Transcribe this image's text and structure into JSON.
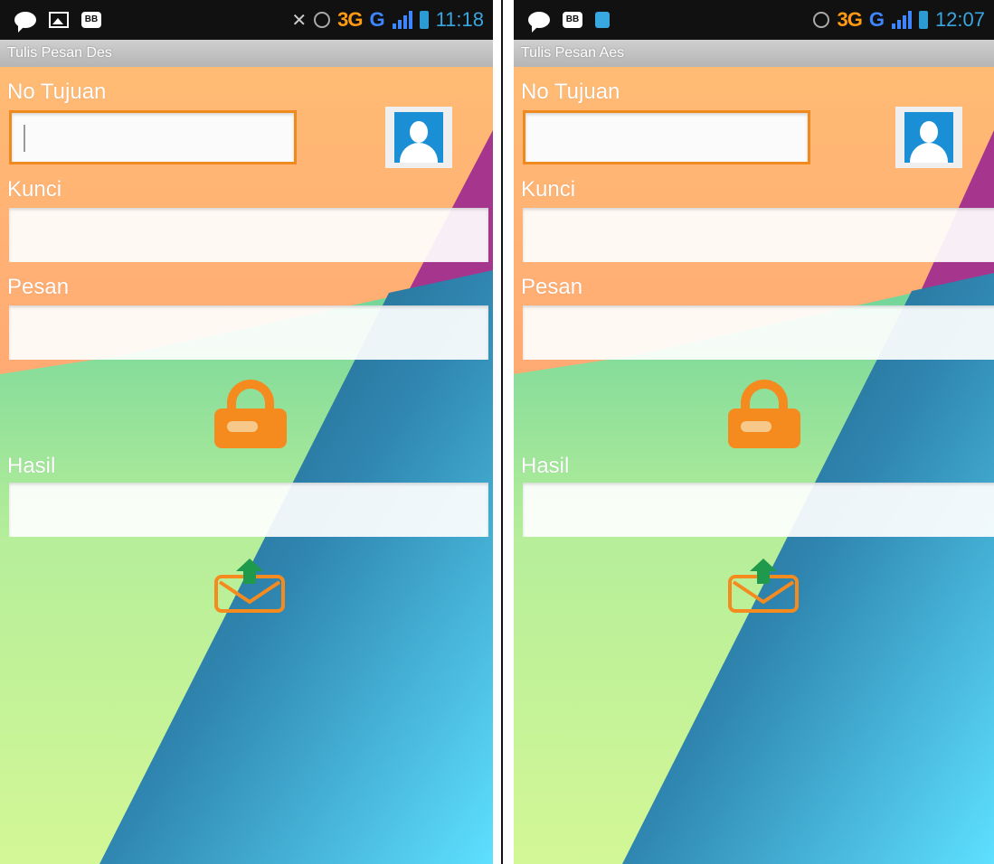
{
  "screens": [
    {
      "title": "Tulis Pesan Des",
      "time": "11:18",
      "network": "3G",
      "network_g": "G",
      "labels": {
        "no_tujuan": "No Tujuan",
        "kunci": "Kunci",
        "pesan": "Pesan",
        "hasil": "Hasil"
      },
      "fields": {
        "no_tujuan": "",
        "kunci": "",
        "pesan": "",
        "hasil": ""
      },
      "status_icons": [
        "line-icon",
        "gallery-icon",
        "bbm-icon",
        "mute-icon",
        "alarm-icon",
        "signal-icon",
        "battery-icon"
      ]
    },
    {
      "title": "Tulis Pesan Aes",
      "time": "12:07",
      "network": "3G",
      "network_g": "G",
      "labels": {
        "no_tujuan": "No Tujuan",
        "kunci": "Kunci",
        "pesan": "Pesan",
        "hasil": "Hasil"
      },
      "fields": {
        "no_tujuan": "",
        "kunci": "",
        "pesan": "",
        "hasil": ""
      },
      "status_icons": [
        "line-icon",
        "bbm-icon",
        "shield-icon",
        "alarm-icon",
        "signal-icon",
        "battery-icon"
      ]
    }
  ],
  "colors": {
    "accent_orange": "#f58b1f",
    "contact_blue": "#1a8fd6",
    "status_bar": "#111111"
  }
}
